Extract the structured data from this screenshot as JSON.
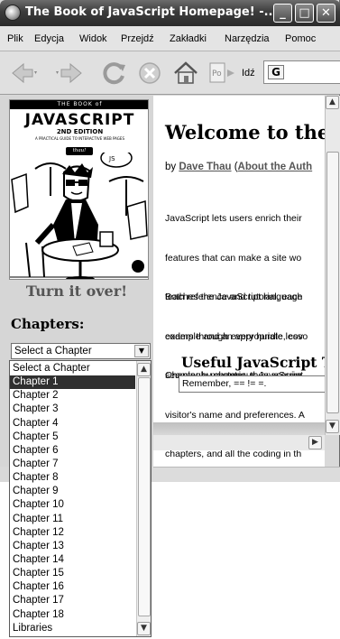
{
  "window": {
    "title": "The Book of JavaScript Homepage! -...",
    "controls": [
      "minimize-icon",
      "maximize-icon",
      "close-icon"
    ]
  },
  "menubar": {
    "items": [
      "Plik",
      "Edycja",
      "Widok",
      "Przejdź",
      "Zakładki",
      "Narzędzia",
      "Pomoc"
    ]
  },
  "toolbar": {
    "buttons": [
      "back-icon",
      "forward-icon",
      "reload-icon",
      "stop-icon",
      "home-icon",
      "page-icon"
    ],
    "go_label": "Idź",
    "address_value": ""
  },
  "sidebar": {
    "cover": {
      "top_line": "THE BOOK of",
      "title": "JAVASCRIPT",
      "edition": "2ND EDITION",
      "subtitle": "A PRACTICAL GUIDE TO INTERACTIVE WEB PAGES",
      "author": "thau!"
    },
    "turn_it_over": "Turn it over!",
    "chapters_heading": "Chapters:",
    "select_value": "Select a Chapter"
  },
  "dropdown": {
    "options": [
      "Select a Chapter",
      "Chapter 1",
      "Chapter 2",
      "Chapter 3",
      "Chapter 4",
      "Chapter 5",
      "Chapter 6",
      "Chapter 7",
      "Chapter 8",
      "Chapter 9",
      "Chapter 10",
      "Chapter 11",
      "Chapter 12",
      "Chapter 13",
      "Chapter 14",
      "Chapter 15",
      "Chapter 16",
      "Chapter 17",
      "Chapter 18",
      "Libraries"
    ],
    "selected_index": 1
  },
  "main": {
    "heading": "Welcome to the",
    "byline_prefix": "by ",
    "author_link": "Dave Thau",
    "byline_paren_open": " (",
    "about_link": "About the Auth",
    "paragraph1": [
      "JavaScript lets users enrich their",
      "features that can make a site wo",
      "teaches the JavaScript language",
      "coders through every hurdle, cov",
      "seemingly mysterious JavaScript"
    ],
    "paragraph2": [
      "Both reference and tutorial, each",
      "example and an appropriate lesso",
      "Chapter by chapter, they acquire",
      "visitor's name and preferences. A",
      "chapters, and all the coding in th"
    ],
    "useful_heading": "Useful JavaScript T",
    "tip_text": "Remember, == != =."
  },
  "colors": {
    "titlebar": "#3c3c3c",
    "sidebar_bg": "#d6d6d6",
    "selected_option_bg": "#2f2f2f",
    "link": "#555555"
  }
}
